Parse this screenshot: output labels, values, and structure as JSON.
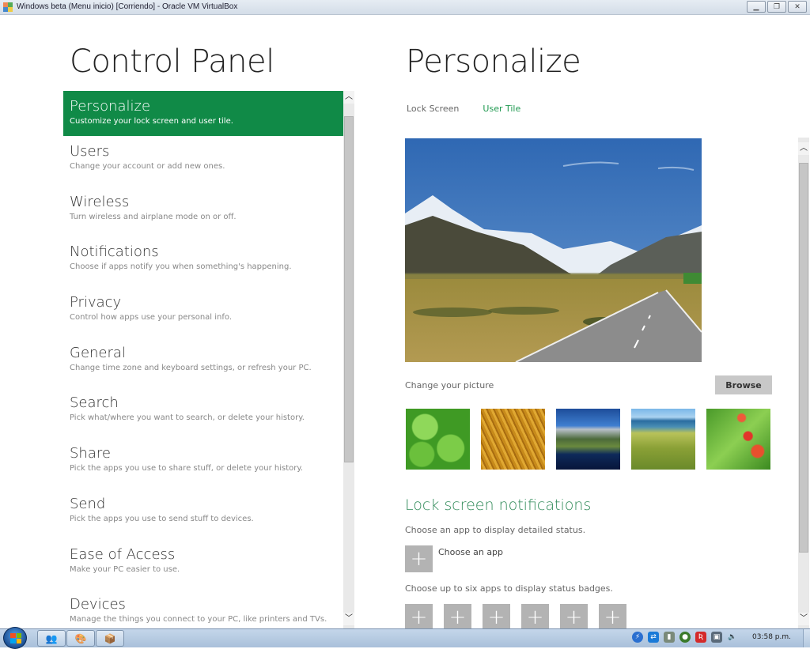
{
  "window": {
    "title": "Windows beta (Menu inicio) [Corriendo] - Oracle VM VirtualBox",
    "buttons": [
      "minimize",
      "restore",
      "close"
    ]
  },
  "control_panel": {
    "title": "Control Panel",
    "nav": [
      {
        "label": "Personalize",
        "desc": "Customize your lock screen and user tile.",
        "active": true
      },
      {
        "label": "Users",
        "desc": "Change your account or add new ones."
      },
      {
        "label": "Wireless",
        "desc": "Turn wireless and airplane mode on or off."
      },
      {
        "label": "Notifications",
        "desc": "Choose if apps notify you when something's happening."
      },
      {
        "label": "Privacy",
        "desc": "Control how apps use your personal info."
      },
      {
        "label": "General",
        "desc": "Change time zone and keyboard settings, or refresh your PC."
      },
      {
        "label": "Search",
        "desc": "Pick what/where you want to search, or delete your history."
      },
      {
        "label": "Share",
        "desc": "Pick the apps you use to share stuff, or delete your history."
      },
      {
        "label": "Send",
        "desc": "Pick the apps you use to send stuff to devices."
      },
      {
        "label": "Ease of Access",
        "desc": "Make your PC easier to use."
      },
      {
        "label": "Devices",
        "desc": "Manage the things you connect to your PC, like printers and TVs."
      }
    ],
    "accent": "#108a47"
  },
  "personalize": {
    "title": "Personalize",
    "tabs": [
      {
        "label": "Lock Screen",
        "active": false
      },
      {
        "label": "User Tile",
        "active": true
      }
    ],
    "hero_image": "mountain-road-landscape",
    "change_picture_label": "Change your picture",
    "browse_label": "Browse",
    "thumbnails": [
      "clover-leaves",
      "golden-grass",
      "mountain-lake",
      "coastal-hills",
      "red-flowers"
    ],
    "lock_screen_notifications": {
      "title": "Lock screen notifications",
      "detail_desc": "Choose an app to display detailed status.",
      "choose_app_label": "Choose an app",
      "badges_desc": "Choose up to six apps to display status badges.",
      "plus_symbol": "+",
      "badge_slots": 6
    }
  },
  "taskbar": {
    "pinned": [
      "users-app",
      "paint-app",
      "virtualbox-app"
    ],
    "tray_icons": [
      "shield-blue",
      "teamviewer",
      "usb-device",
      "network-globe",
      "avira",
      "network",
      "volume"
    ],
    "clock": "03:58 p.m."
  }
}
